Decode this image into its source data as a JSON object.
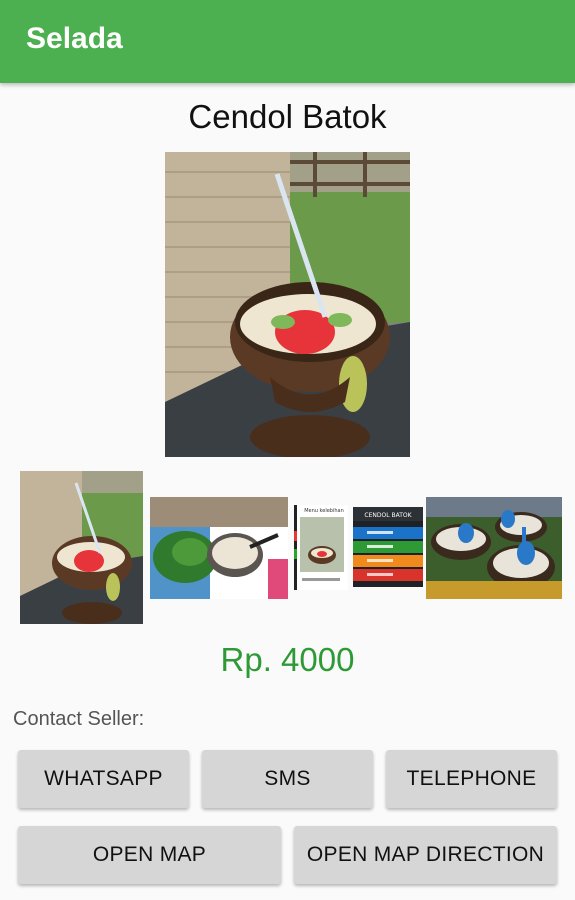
{
  "app_bar": {
    "title": "Selada",
    "color": "#4caf50"
  },
  "product": {
    "name": "Cendol Batok",
    "price": "Rp. 4000",
    "price_color": "#2e9a35"
  },
  "gallery": {
    "main_image": "cendol-in-coconut-shell-photo",
    "thumbnails": [
      "cendol-in-coconut-shell-photo",
      "cendol-bowl-with-leaves-photo",
      "menu-screenshot-photo",
      "app-menu-screenshot-photo",
      "cendol-bowls-with-spoons-photo"
    ],
    "menu_caption": "Menu kelebihan",
    "app_menu_header": "CENDOL BATOK"
  },
  "contact": {
    "label": "Contact Seller:",
    "buttons": {
      "whatsapp": "WHATSAPP",
      "sms": "SMS",
      "telephone": "TELEPHONE",
      "open_map": "OPEN MAP",
      "open_map_direction": "OPEN MAP DIRECTION"
    }
  }
}
